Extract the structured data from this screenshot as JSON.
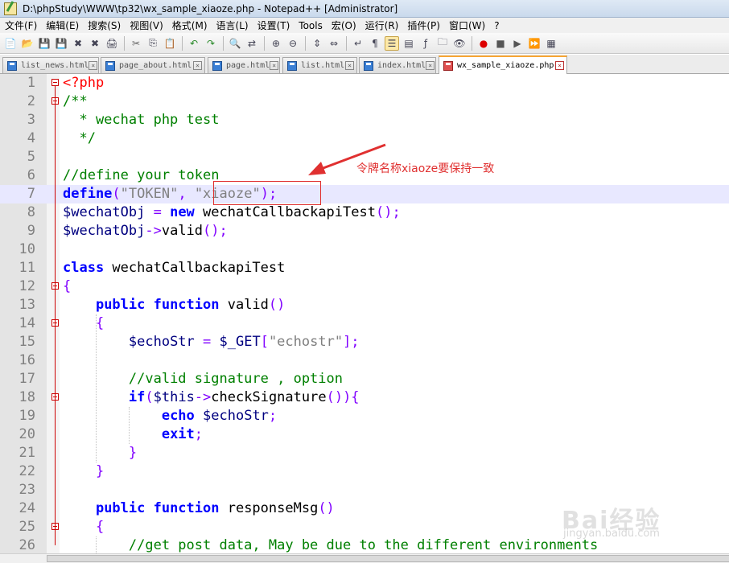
{
  "window": {
    "title": "D:\\phpStudy\\WWW\\tp32\\wx_sample_xiaoze.php - Notepad++ [Administrator]"
  },
  "menu": [
    "文件(F)",
    "编辑(E)",
    "搜索(S)",
    "视图(V)",
    "格式(M)",
    "语言(L)",
    "设置(T)",
    "Tools",
    "宏(O)",
    "运行(R)",
    "插件(P)",
    "窗口(W)",
    "?"
  ],
  "toolbar": [
    "new-file-icon",
    "open-file-icon",
    "save-icon",
    "save-all-icon",
    "close-icon",
    "close-all-icon",
    "print-icon",
    "cut-icon",
    "copy-icon",
    "paste-icon",
    "undo-icon",
    "redo-icon",
    "find-icon",
    "replace-icon",
    "zoom-in-icon",
    "zoom-out-icon",
    "sync-v-icon",
    "sync-h-icon",
    "word-wrap-icon",
    "show-all-chars-icon",
    "indent-guide-icon",
    "doc-map-icon",
    "function-list-icon",
    "folder-workspace-icon",
    "monitor-icon",
    "record-macro-icon",
    "stop-record-icon",
    "play-macro-icon",
    "run-macro-multiple-icon",
    "save-macro-icon"
  ],
  "tabs": [
    {
      "label": "list_news.html",
      "active": false
    },
    {
      "label": "page_about.html",
      "active": false
    },
    {
      "label": "page.html",
      "active": false
    },
    {
      "label": "list.html",
      "active": false
    },
    {
      "label": "index.html",
      "active": false
    },
    {
      "label": "wx_sample_xiaoze.php",
      "active": true
    }
  ],
  "editor": {
    "current_line": 7,
    "lines": [
      {
        "n": "1",
        "fold": true,
        "segs": [
          [
            "php",
            "<?php"
          ]
        ]
      },
      {
        "n": "2",
        "fold": true,
        "segs": [
          [
            "cm",
            "/**"
          ]
        ]
      },
      {
        "n": "3",
        "segs": [
          [
            "cm",
            "  * wechat php test"
          ]
        ]
      },
      {
        "n": "4",
        "segs": [
          [
            "cm",
            "  */"
          ]
        ]
      },
      {
        "n": "5",
        "segs": []
      },
      {
        "n": "6",
        "segs": [
          [
            "cm",
            "//define your token"
          ]
        ]
      },
      {
        "n": "7",
        "segs": [
          [
            "kw",
            "define"
          ],
          [
            "op",
            "("
          ],
          [
            "str",
            "\"TOKEN\""
          ],
          [
            "op",
            ", "
          ],
          [
            "str",
            "\"xiaoze\""
          ],
          [
            "op",
            ");"
          ]
        ]
      },
      {
        "n": "8",
        "segs": [
          [
            "var",
            "$wechatObj"
          ],
          [
            "op",
            " = "
          ],
          [
            "kw",
            "new"
          ],
          [
            "fn",
            " wechatCallbackapiTest"
          ],
          [
            "op",
            "();"
          ]
        ]
      },
      {
        "n": "9",
        "segs": [
          [
            "var",
            "$wechatObj"
          ],
          [
            "op",
            "->"
          ],
          [
            "fn",
            "valid"
          ],
          [
            "op",
            "();"
          ]
        ]
      },
      {
        "n": "10",
        "segs": []
      },
      {
        "n": "11",
        "segs": [
          [
            "kw",
            "class"
          ],
          [
            "fn",
            " wechatCallbackapiTest"
          ]
        ]
      },
      {
        "n": "12",
        "fold": true,
        "segs": [
          [
            "op",
            "{"
          ]
        ]
      },
      {
        "n": "13",
        "segs": [
          [
            "fn",
            "    "
          ],
          [
            "kw",
            "public function"
          ],
          [
            "fn",
            " valid"
          ],
          [
            "op",
            "()"
          ]
        ]
      },
      {
        "n": "14",
        "fold": true,
        "segs": [
          [
            "fn",
            "    "
          ],
          [
            "op",
            "{"
          ]
        ]
      },
      {
        "n": "15",
        "segs": [
          [
            "fn",
            "        "
          ],
          [
            "var",
            "$echoStr"
          ],
          [
            "op",
            " = "
          ],
          [
            "var",
            "$_GET"
          ],
          [
            "op",
            "["
          ],
          [
            "str",
            "\"echostr\""
          ],
          [
            "op",
            "];"
          ]
        ]
      },
      {
        "n": "16",
        "segs": []
      },
      {
        "n": "17",
        "segs": [
          [
            "fn",
            "        "
          ],
          [
            "cm",
            "//valid signature , option"
          ]
        ]
      },
      {
        "n": "18",
        "fold": true,
        "segs": [
          [
            "fn",
            "        "
          ],
          [
            "kw",
            "if"
          ],
          [
            "op",
            "("
          ],
          [
            "var",
            "$this"
          ],
          [
            "op",
            "->"
          ],
          [
            "fn",
            "checkSignature"
          ],
          [
            "op",
            "()){"
          ]
        ]
      },
      {
        "n": "19",
        "segs": [
          [
            "fn",
            "            "
          ],
          [
            "kw",
            "echo"
          ],
          [
            "fn",
            " "
          ],
          [
            "var",
            "$echoStr"
          ],
          [
            "op",
            ";"
          ]
        ]
      },
      {
        "n": "20",
        "segs": [
          [
            "fn",
            "            "
          ],
          [
            "kw",
            "exit"
          ],
          [
            "op",
            ";"
          ]
        ]
      },
      {
        "n": "21",
        "segs": [
          [
            "fn",
            "        "
          ],
          [
            "op",
            "}"
          ]
        ]
      },
      {
        "n": "22",
        "segs": [
          [
            "fn",
            "    "
          ],
          [
            "op",
            "}"
          ]
        ]
      },
      {
        "n": "23",
        "segs": []
      },
      {
        "n": "24",
        "segs": [
          [
            "fn",
            "    "
          ],
          [
            "kw",
            "public function"
          ],
          [
            "fn",
            " responseMsg"
          ],
          [
            "op",
            "()"
          ]
        ]
      },
      {
        "n": "25",
        "fold": true,
        "segs": [
          [
            "fn",
            "    "
          ],
          [
            "op",
            "{"
          ]
        ]
      },
      {
        "n": "26",
        "segs": [
          [
            "fn",
            "        "
          ],
          [
            "cm",
            "//get post data, May be due to the different environments"
          ]
        ]
      }
    ]
  },
  "annotation": {
    "text": "令牌名称xiaoze要保持一致",
    "color": "#e03030"
  },
  "watermark": {
    "text": "Bai经验",
    "sub": "jingyan.baidu.com"
  }
}
